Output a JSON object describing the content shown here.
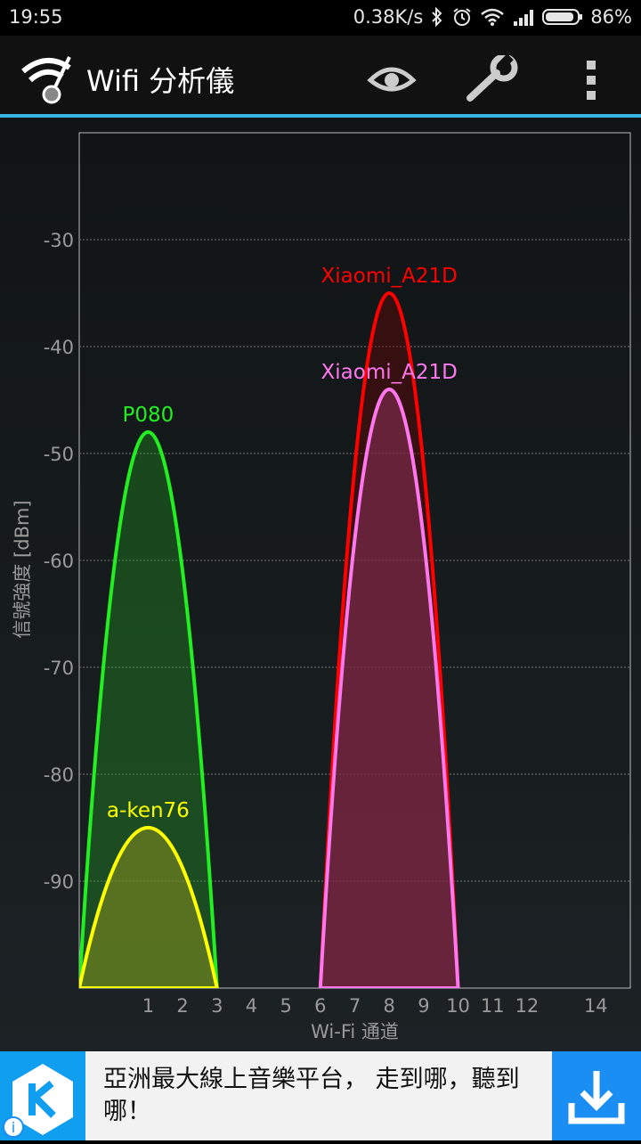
{
  "status_bar": {
    "time": "19:55",
    "net_speed": "0.38K/s",
    "battery": "86%",
    "icons": [
      "bluetooth-icon",
      "alarm-icon",
      "wifi-signal-icon",
      "cell-signal-icon",
      "battery-icon"
    ]
  },
  "app_bar": {
    "title": "Wifi 分析儀",
    "icons": [
      "wifi-analyzer-logo-icon",
      "eye-icon",
      "wrench-icon",
      "more-vert-icon"
    ],
    "accent": "#33b5e5"
  },
  "chart_data": {
    "type": "area",
    "xlabel": "Wi-Fi 通道",
    "ylabel": "信號強度 [dBm]",
    "x_ticks": [
      "1",
      "2",
      "3",
      "4",
      "5",
      "6",
      "7",
      "8",
      "9",
      "10",
      "11",
      "12",
      "14"
    ],
    "y_ticks": [
      "-30",
      "-40",
      "-50",
      "-60",
      "-70",
      "-80",
      "-90"
    ],
    "ylim": [
      -100,
      -20
    ],
    "xlim": [
      -1,
      15
    ],
    "grid": true,
    "series": [
      {
        "name": "P080",
        "channel": 1,
        "peak_dbm": -48,
        "color": "#22ee22",
        "fill": "rgba(34,160,34,0.35)"
      },
      {
        "name": "a-ken76",
        "channel": 1,
        "peak_dbm": -85,
        "color": "#ffff00",
        "fill": "rgba(160,160,30,0.45)"
      },
      {
        "name": "Xiaomi_A21D",
        "channel": 8,
        "peak_dbm": -35,
        "color": "#ff0000",
        "fill": "rgba(120,0,0,0.35)"
      },
      {
        "name": "Xiaomi_A21D",
        "channel": 8,
        "peak_dbm": -44,
        "color": "#ff77ee",
        "fill": "rgba(140,50,90,0.55)"
      }
    ]
  },
  "ad": {
    "text": "亞洲最大線上音樂平台， 走到哪，聽到哪！",
    "logo_letter": "K",
    "info_glyph": "i"
  }
}
